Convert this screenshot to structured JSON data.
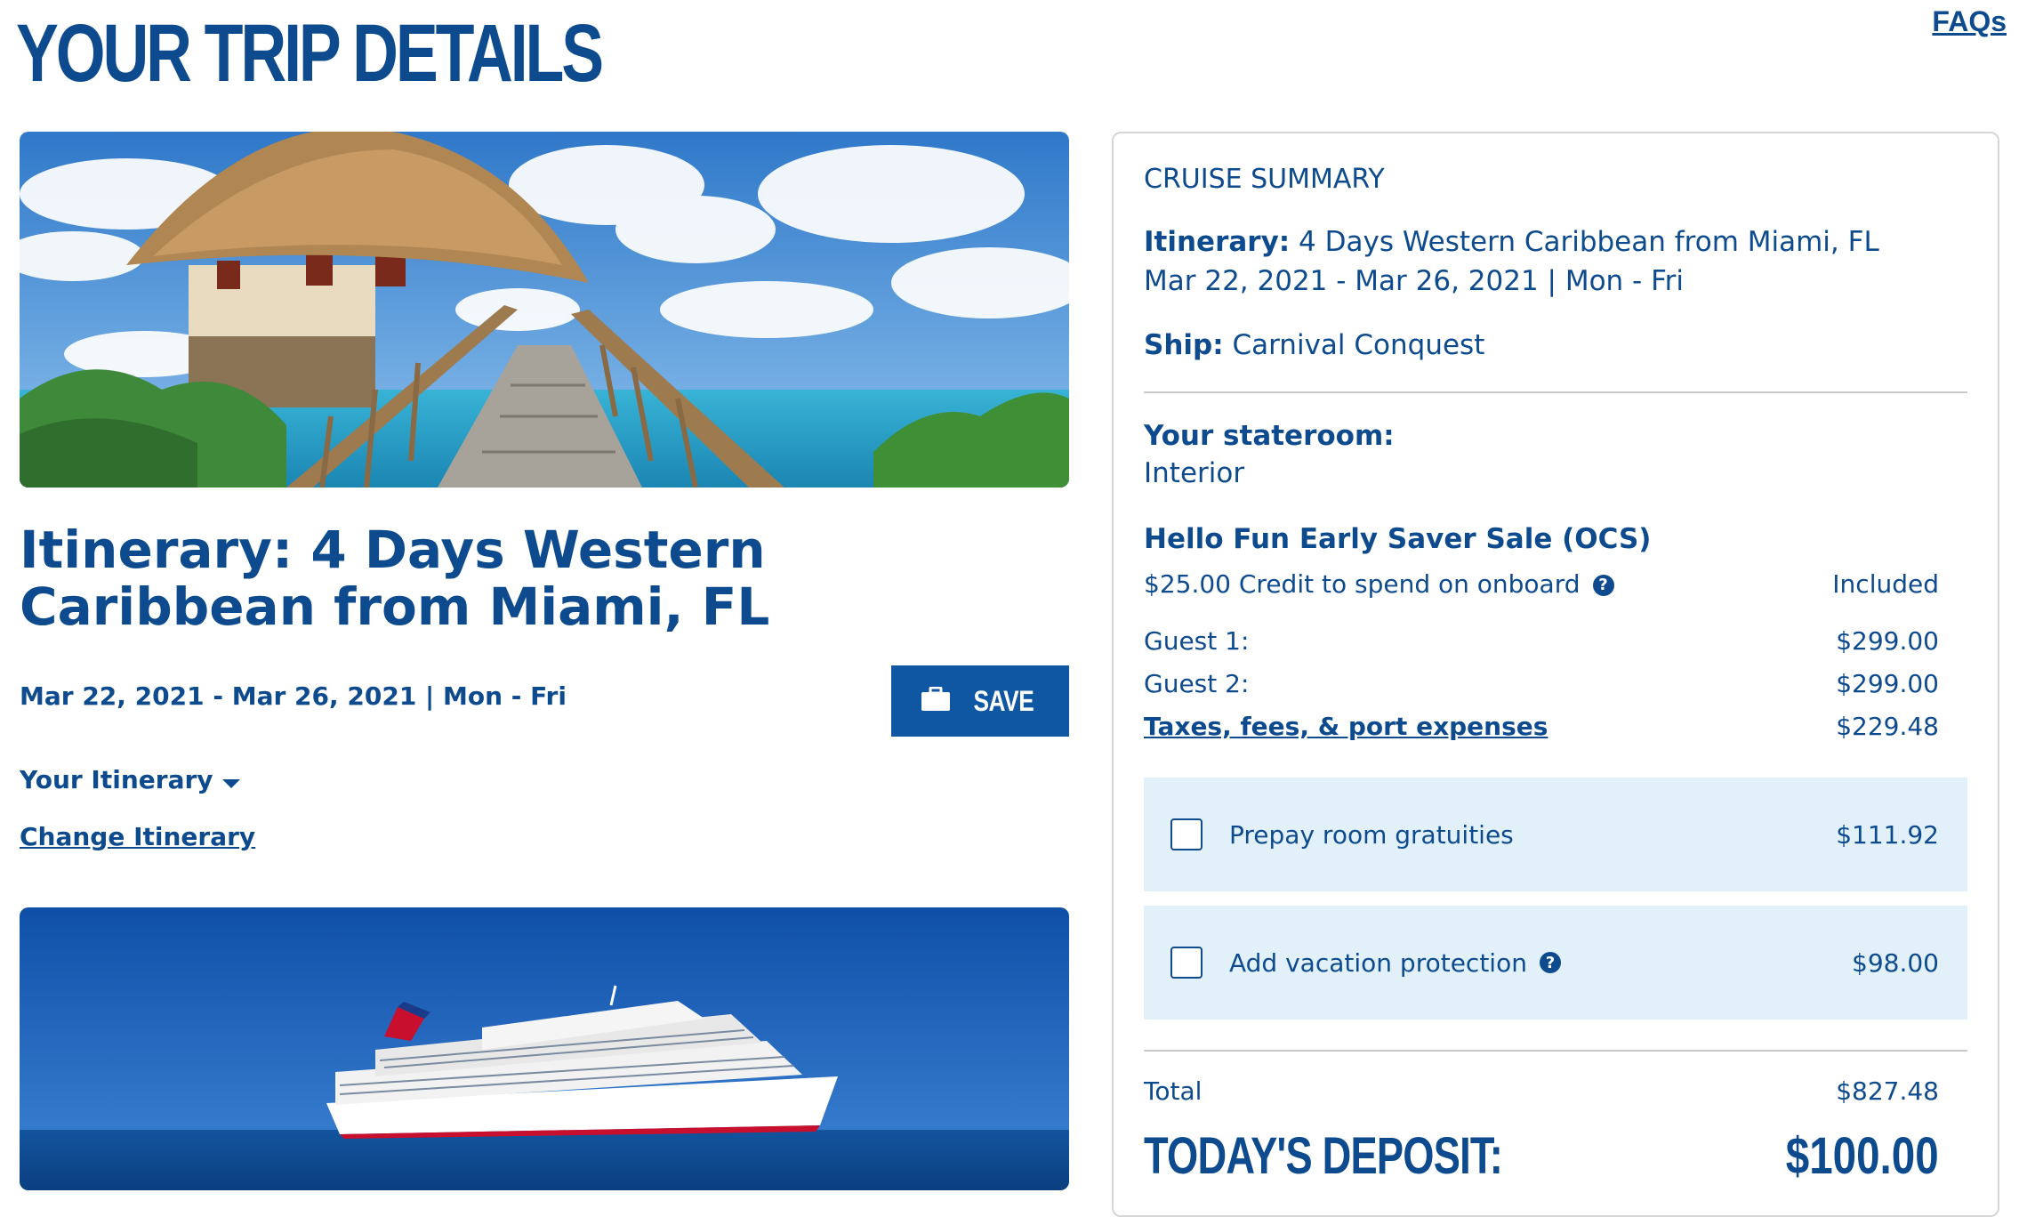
{
  "header": {
    "title": "YOUR TRIP DETAILS",
    "faq_label": "FAQs"
  },
  "trip": {
    "itinerary_title": "Itinerary: 4 Days Western Caribbean from Miami, FL",
    "dates": "Mar 22, 2021 - Mar 26, 2021 | Mon - Fri",
    "save_label": "SAVE",
    "your_itinerary_label": "Your Itinerary",
    "change_itinerary_label": "Change Itinerary"
  },
  "summary": {
    "heading": "CRUISE SUMMARY",
    "itinerary_label": "Itinerary:",
    "itinerary_value": "4 Days Western Caribbean from Miami, FL",
    "dates": "Mar 22, 2021 - Mar 26, 2021 | Mon - Fri",
    "ship_label": "Ship:",
    "ship_value": "Carnival Conquest",
    "stateroom_label": "Your stateroom:",
    "stateroom_value": "Interior",
    "promo_title": "Hello Fun Early Saver Sale (OCS)",
    "credit_label": "$25.00 Credit to spend on onboard",
    "credit_value": "Included",
    "guest1_label": "Guest 1:",
    "guest1_value": "$299.00",
    "guest2_label": "Guest 2:",
    "guest2_value": "$299.00",
    "taxes_label": "Taxes, fees, & port expenses",
    "taxes_value": "$229.48",
    "gratuities_label": "Prepay room gratuities",
    "gratuities_value": "$111.92",
    "gratuities_checked": false,
    "protection_label": "Add vacation protection",
    "protection_value": "$98.00",
    "protection_checked": false,
    "total_label": "Total",
    "total_value": "$827.48",
    "deposit_label": "TODAY'S DEPOSIT:",
    "deposit_value": "$100.00"
  },
  "colors": {
    "brand_blue": "#0d4b8e",
    "button_blue": "#0f57a3",
    "option_bg": "#e2f0fa"
  }
}
